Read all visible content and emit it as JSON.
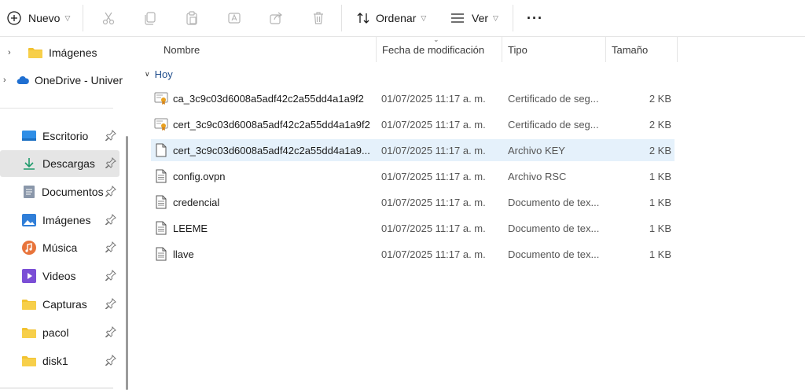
{
  "toolbar": {
    "new_label": "Nuevo",
    "sort_label": "Ordenar",
    "view_label": "Ver",
    "more_label": "···"
  },
  "sidebar": {
    "tree": [
      {
        "label": "Imágenes",
        "icon": "folder-icon"
      },
      {
        "label": "OneDrive - Univer",
        "icon": "onedrive-cloud-icon"
      }
    ],
    "quick_access": [
      {
        "label": "Escritorio",
        "icon": "desktop-icon",
        "color": "#2f8ee6"
      },
      {
        "label": "Descargas",
        "icon": "download-icon",
        "color": "#1f9a6b"
      },
      {
        "label": "Documentos",
        "icon": "document-icon",
        "color": "#6b7a8f"
      },
      {
        "label": "Imágenes",
        "icon": "pictures-icon",
        "color": "#2f7ed8"
      },
      {
        "label": "Música",
        "icon": "music-icon",
        "color": "#e8743b"
      },
      {
        "label": "Videos",
        "icon": "video-icon",
        "color": "#7b4fd6"
      },
      {
        "label": "Capturas",
        "icon": "folder-icon",
        "color": "#f2c230"
      },
      {
        "label": "pacol",
        "icon": "folder-icon",
        "color": "#f2c230"
      },
      {
        "label": "disk1",
        "icon": "folder-icon",
        "color": "#f2c230"
      }
    ],
    "selected_index": 1
  },
  "columns": {
    "name": "Nombre",
    "date": "Fecha de modificación",
    "type": "Tipo",
    "size": "Tamaño"
  },
  "group": {
    "label": "Hoy"
  },
  "files": [
    {
      "name": "ca_3c9c03d6008a5adf42c2a55dd4a1a9f2",
      "date": "01/07/2025 11:17 a. m.",
      "type": "Certificado de seg...",
      "size": "2 KB",
      "icon": "certificate-icon"
    },
    {
      "name": "cert_3c9c03d6008a5adf42c2a55dd4a1a9f2",
      "date": "01/07/2025 11:17 a. m.",
      "type": "Certificado de seg...",
      "size": "2 KB",
      "icon": "certificate-icon"
    },
    {
      "name": "cert_3c9c03d6008a5adf42c2a55dd4a1a9...",
      "date": "01/07/2025 11:17 a. m.",
      "type": "Archivo KEY",
      "size": "2 KB",
      "icon": "blank-file-icon"
    },
    {
      "name": "config.ovpn",
      "date": "01/07/2025 11:17 a. m.",
      "type": "Archivo RSC",
      "size": "1 KB",
      "icon": "text-file-icon"
    },
    {
      "name": "credencial",
      "date": "01/07/2025 11:17 a. m.",
      "type": "Documento de tex...",
      "size": "1 KB",
      "icon": "text-file-icon"
    },
    {
      "name": "LEEME",
      "date": "01/07/2025 11:17 a. m.",
      "type": "Documento de tex...",
      "size": "1 KB",
      "icon": "text-file-icon"
    },
    {
      "name": "llave",
      "date": "01/07/2025 11:17 a. m.",
      "type": "Documento de tex...",
      "size": "1 KB",
      "icon": "text-file-icon"
    }
  ],
  "selected_file_index": 2
}
